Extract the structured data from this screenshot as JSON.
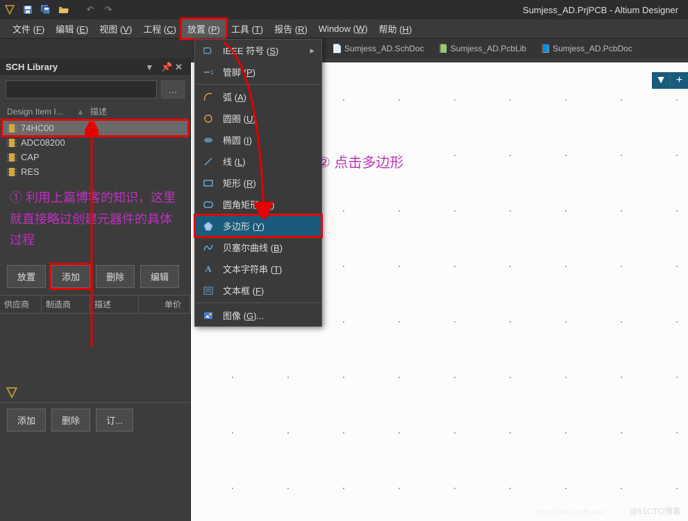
{
  "title": "Sumjess_AD.PrjPCB - Altium Designer",
  "menubar": [
    "文件 (F)",
    "编辑 (E)",
    "视图 (V)",
    "工程 (C)",
    "放置 (P)",
    "工具 (T)",
    "报告 (R)",
    "Window (W)",
    "帮助 (H)"
  ],
  "menubar_u": [
    "F",
    "E",
    "V",
    "C",
    "P",
    "T",
    "R",
    "W",
    "H"
  ],
  "tabs": [
    {
      "label": "Sumjess_AD.SchDoc",
      "icon": "sch"
    },
    {
      "label": "Sumjess_AD.PcbLib",
      "icon": "pcblib"
    },
    {
      "label": "Sumjess_AD.PcbDoc",
      "icon": "pcb"
    }
  ],
  "panel": {
    "title": "SCH Library",
    "cols": [
      "Design Item I...",
      "描述"
    ],
    "items": [
      "74HC00",
      "ADC08200",
      "CAP",
      "RES"
    ],
    "annotation": "① 利用上篇博客的知识，这里就直接略过创建元器件的具体过程",
    "buttons1": [
      "放置",
      "添加",
      "删除",
      "编辑"
    ],
    "tblcols": [
      "供应商",
      "制造商",
      "描述",
      "单价"
    ],
    "buttons2": [
      "添加",
      "删除",
      "订..."
    ]
  },
  "dropdown": [
    {
      "label": "IEEE 符号 (S)",
      "u": "S",
      "icon": "ieee",
      "arrow": true
    },
    {
      "label": "管脚 (P)",
      "u": "P",
      "icon": "pin"
    },
    {
      "sep": true
    },
    {
      "label": "弧 (A)",
      "u": "A",
      "icon": "arc"
    },
    {
      "label": "圆圈 (U)",
      "u": "U",
      "icon": "circle"
    },
    {
      "label": "椭圆 (I)",
      "u": "I",
      "icon": "ellipse"
    },
    {
      "label": "线 (L)",
      "u": "L",
      "icon": "line"
    },
    {
      "label": "矩形 (R)",
      "u": "R",
      "icon": "rect"
    },
    {
      "label": "圆角矩形 (O)",
      "u": "O",
      "icon": "roundrect"
    },
    {
      "label": "多边形 (Y)",
      "u": "Y",
      "icon": "polygon",
      "hl": true
    },
    {
      "label": "贝塞尔曲线 (B)",
      "u": "B",
      "icon": "bezier"
    },
    {
      "label": "文本字符串 (T)",
      "u": "T",
      "icon": "text"
    },
    {
      "label": "文本框 (F)",
      "u": "F",
      "icon": "textbox"
    },
    {
      "sep": true
    },
    {
      "label": "图像 (G)...",
      "u": "G",
      "icon": "image"
    }
  ],
  "annotation2": "② 点击多边形",
  "watermark": "@51CTO博客",
  "watermark2": "https://blog.csdn.net/"
}
